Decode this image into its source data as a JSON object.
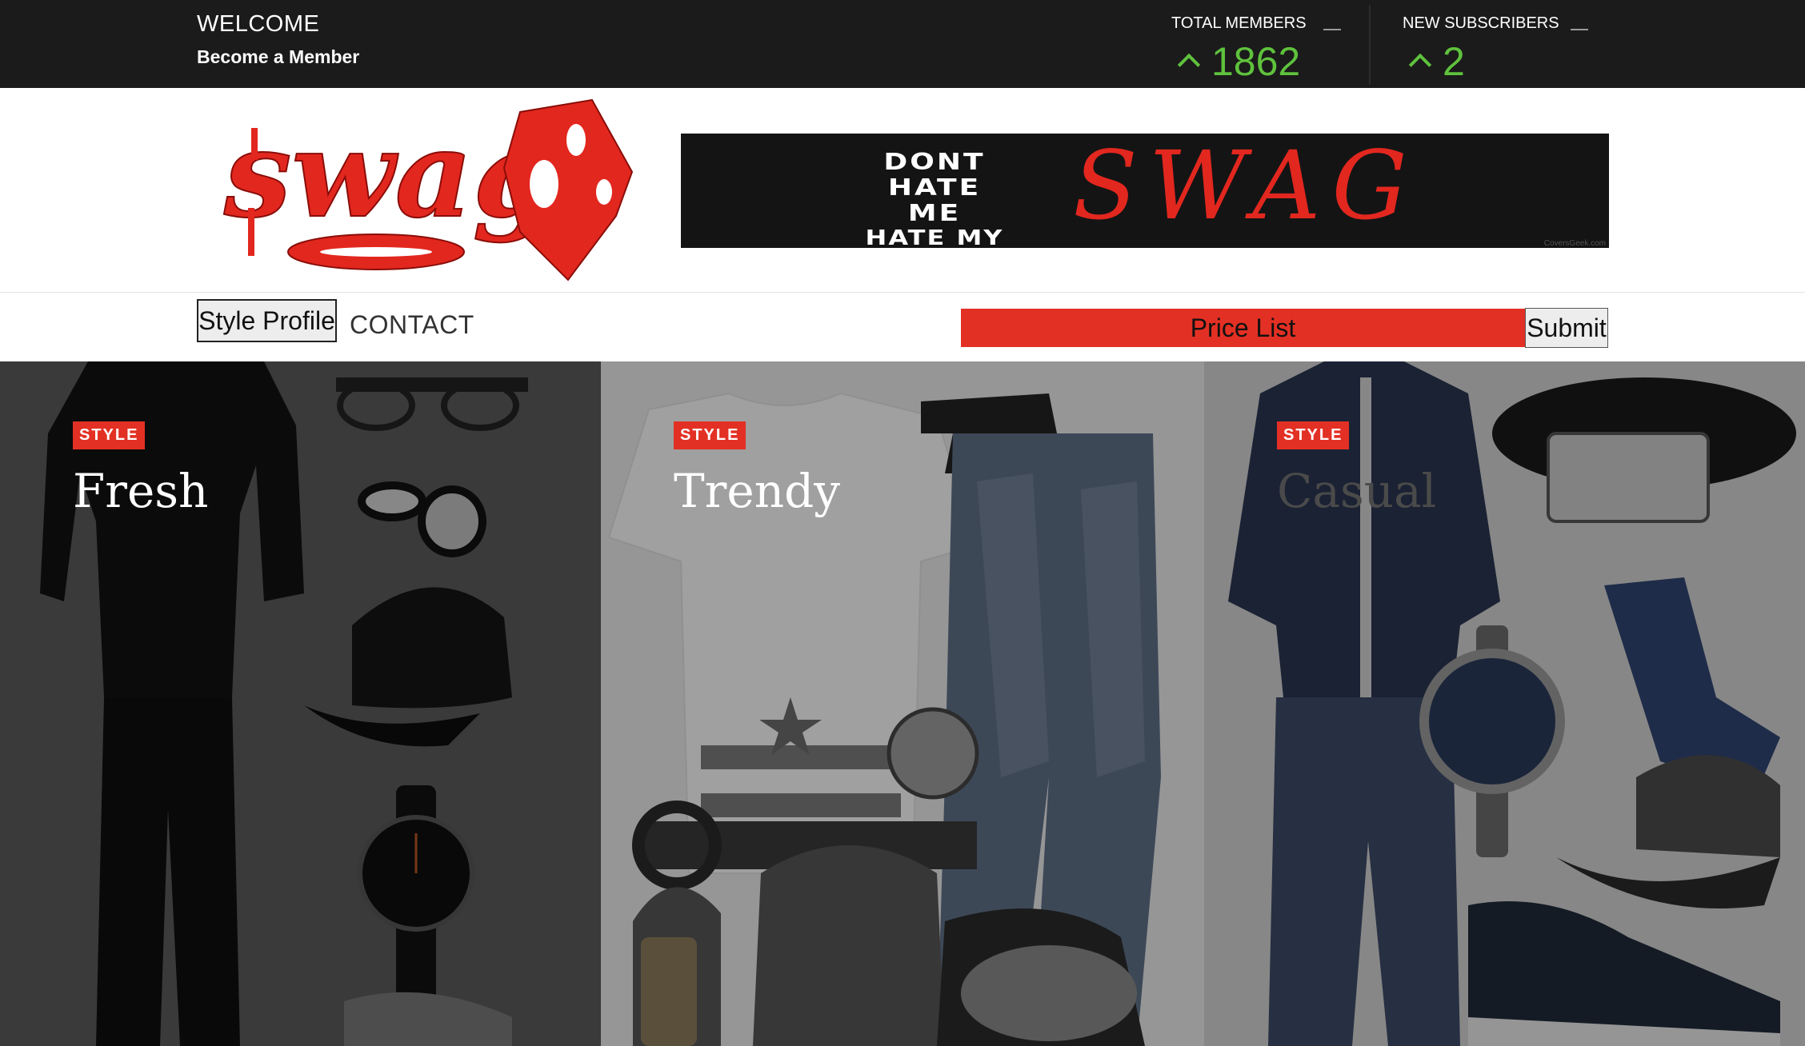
{
  "topbar": {
    "welcome": "WELCOME",
    "become_member": "Become a Member",
    "stats": [
      {
        "label": "TOTAL MEMBERS",
        "value": "1862"
      },
      {
        "label": "NEW SUBSCRIBERS",
        "value": "2"
      }
    ]
  },
  "header": {
    "logo_text": "swag",
    "banner": {
      "stack_lines": [
        "DONT",
        "HATE",
        "ME",
        "HATE MY"
      ],
      "swag_text": "SWAG",
      "credit": "CoversGeek.com"
    }
  },
  "nav": {
    "style_profile": "Style Profile",
    "contact": "CONTACT",
    "price_list": "Price List",
    "submit": "Submit"
  },
  "cards": [
    {
      "badge": "STYLE",
      "title": "Fresh"
    },
    {
      "badge": "STYLE",
      "title": "Trendy"
    },
    {
      "badge": "STYLE",
      "title": "Casual"
    }
  ],
  "colors": {
    "topbar_bg": "#1b1b1b",
    "accent_red": "#e33024",
    "stat_green": "#5fc23d"
  },
  "icons": {
    "stat_trend": "chevron-up-icon"
  }
}
